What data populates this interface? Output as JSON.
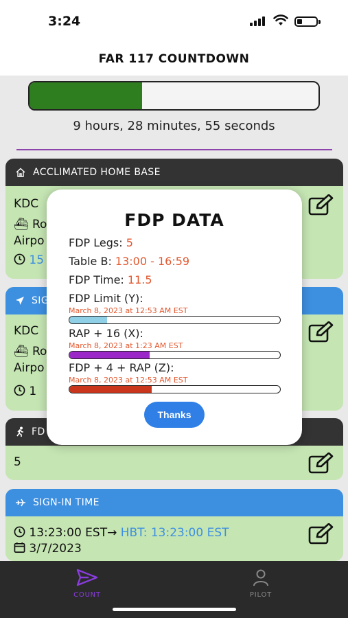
{
  "status": {
    "time": "3:24"
  },
  "header": {
    "title": "FAR 117 COUNTDOWN"
  },
  "progress": {
    "fraction": 0.39,
    "fill_color": "#2e7d1f",
    "countdown_text": "9 hours, 28 minutes, 55 seconds"
  },
  "cards": {
    "home_base": {
      "title": "ACCLIMATED HOME BASE",
      "code": "KDC",
      "line2": "Ro",
      "line3": "Airpo",
      "line4": "15"
    },
    "sign_in_loc": {
      "title": "SIG",
      "code": "KDC",
      "line2": "Ro",
      "line3": "Airpo",
      "line4": "1"
    },
    "fdp_legs": {
      "title": "FD",
      "value": "5"
    },
    "sign_in_time": {
      "title": "SIGN-IN TIME",
      "time": "13:23:00 EST",
      "hbt": "HBT: 13:23:00 EST",
      "date": "3/7/2023"
    }
  },
  "modal": {
    "title": "FDP DATA",
    "legs_label": "FDP Legs:",
    "legs_value": "5",
    "tableb_label": "Table B:",
    "tableb_value": "13:00 - 16:59",
    "time_label": "FDP Time:",
    "time_value": "11.5",
    "limit_label": "FDP Limit (Y):",
    "limit_date": "March 8, 2023 at 12:53 AM EST",
    "limit_fraction": 0.18,
    "limit_color": "#8fd0e6",
    "rap_label": "RAP + 16 (X):",
    "rap_date": "March 8, 2023 at 1:23 AM EST",
    "rap_fraction": 0.38,
    "rap_color": "#9b27c9",
    "fdp4_label": "FDP + 4 + RAP (Z):",
    "fdp4_date": "March 8, 2023 at 12:53 AM EST",
    "fdp4_fraction": 0.39,
    "fdp4_color": "#c9361b",
    "button": "Thanks"
  },
  "tabs": {
    "count": "COUNT",
    "pilot": "PILOT"
  }
}
